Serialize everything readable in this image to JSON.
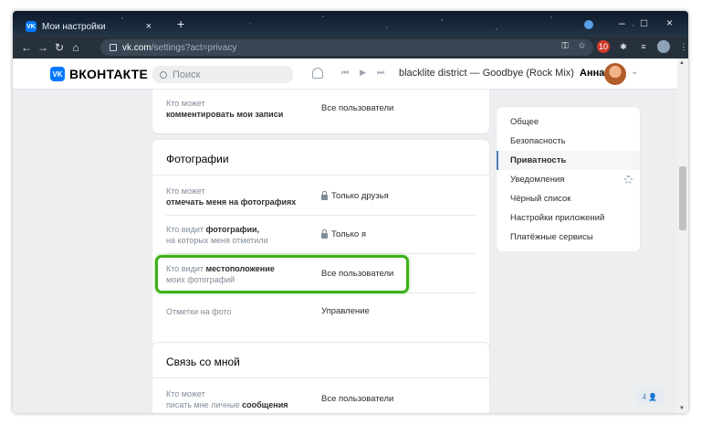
{
  "browser": {
    "tab_title": "Мои настройки",
    "tab_close": "×",
    "new_tab": "+",
    "window_controls": [
      "–",
      "□",
      "×"
    ],
    "url_host": "vk.com",
    "url_path": "/settings?act=privacy",
    "nav_icons": [
      "back-icon",
      "forward-icon",
      "reload-icon",
      "home-icon"
    ],
    "extension_badge": "10"
  },
  "header": {
    "logo_glyph": "VK",
    "wordmark": "ВКОНТАКТЕ",
    "search_placeholder": "Поиск",
    "track": "blacklite district — Goodbye (Rock Mix)",
    "user_name": "Анна"
  },
  "top_row": {
    "label_plain": "Кто может",
    "label_bold": "комментировать мои записи",
    "value": "Все пользователи"
  },
  "photos": {
    "title": "Фотографии",
    "rows": [
      {
        "label_plain": "Кто может",
        "label_bold": "отмечать меня на фотографиях",
        "value": "Только друзья",
        "locked": true
      },
      {
        "label_plain": "Кто видит",
        "label_bold": "фотографии,",
        "label_tail": "на которых меня отметили",
        "value": "Только я",
        "locked": true
      },
      {
        "label_plain": "Кто видит",
        "label_bold": "местоположение",
        "label_tail": "моих фотографий",
        "value": "Все пользователи",
        "locked": false
      },
      {
        "label_plain": "Отметки на фото",
        "value": "Управление",
        "locked": false
      }
    ]
  },
  "contact": {
    "title": "Связь со мной",
    "row": {
      "label_plain": "Кто может",
      "label_tail": "писать мне личные",
      "label_bold": "сообщения",
      "value": "Все пользователи"
    }
  },
  "menu": {
    "items": [
      "Общее",
      "Безопасность",
      "Приватность",
      "Уведомления",
      "Чёрный список",
      "Настройки приложений",
      "Платёжные сервисы"
    ],
    "active_index": 2
  },
  "contacts_badge": "4 👤",
  "colors": {
    "vk_blue": "#0077ff",
    "highlight_green": "#3cb018",
    "page_bg": "#edeef0"
  }
}
